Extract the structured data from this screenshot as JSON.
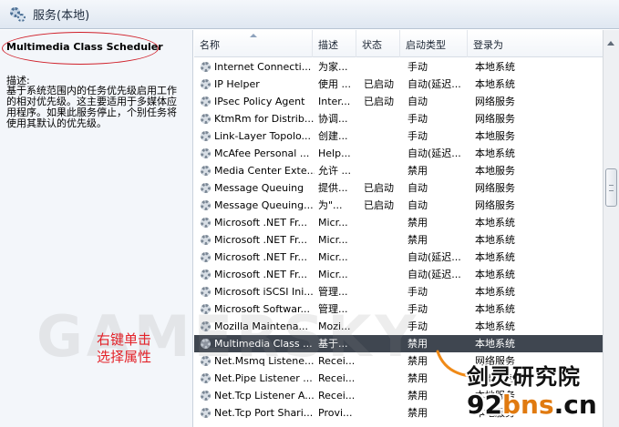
{
  "window": {
    "title": "服务(本地)"
  },
  "details": {
    "service_name": "Multimedia Class Scheduler",
    "desc_label": "描述:",
    "desc_text": "基于系统范围内的任务优先级启用工作的相对优先级。这主要适用于多媒体应用程序。如果此服务停止，个别任务将使用其默认的优先级。"
  },
  "table": {
    "columns": [
      "名称",
      "描述",
      "状态",
      "启动类型",
      "登录为"
    ],
    "rows": [
      [
        "Internet Connecti...",
        "为家...",
        "",
        "手动",
        "本地系统"
      ],
      [
        "IP Helper",
        "使用 ...",
        "已启动",
        "自动(延迟...",
        "本地系统"
      ],
      [
        "IPsec Policy Agent",
        "Inter...",
        "已启动",
        "自动",
        "网络服务"
      ],
      [
        "KtmRm for Distrib...",
        "协调...",
        "",
        "手动",
        "网络服务"
      ],
      [
        "Link-Layer Topolo...",
        "创建...",
        "",
        "手动",
        "本地服务"
      ],
      [
        "McAfee Personal ...",
        "Help...",
        "",
        "自动(延迟...",
        "本地系统"
      ],
      [
        "Media Center Exte...",
        "允许 ...",
        "",
        "禁用",
        "本地服务"
      ],
      [
        "Message Queuing",
        "提供...",
        "已启动",
        "自动",
        "网络服务"
      ],
      [
        "Message Queuing...",
        "为\"...",
        "已启动",
        "自动",
        "网络服务"
      ],
      [
        "Microsoft .NET Fr...",
        "Micr...",
        "",
        "禁用",
        "本地系统"
      ],
      [
        "Microsoft .NET Fr...",
        "Micr...",
        "",
        "禁用",
        "本地系统"
      ],
      [
        "Microsoft .NET Fr...",
        "Micr...",
        "",
        "自动(延迟...",
        "本地系统"
      ],
      [
        "Microsoft .NET Fr...",
        "Micr...",
        "",
        "自动(延迟...",
        "本地系统"
      ],
      [
        "Microsoft iSCSI Ini...",
        "管理...",
        "",
        "手动",
        "本地系统"
      ],
      [
        "Microsoft Softwar...",
        "管理...",
        "",
        "手动",
        "本地系统"
      ],
      [
        "Mozilla Maintena...",
        "Mozi...",
        "",
        "手动",
        "本地系统"
      ],
      [
        "Multimedia Class ...",
        "基于...",
        "",
        "禁用",
        "本地系统"
      ],
      [
        "Net.Msmq Listene...",
        "Recei...",
        "",
        "禁用",
        "网络服务"
      ],
      [
        "Net.Pipe Listener ...",
        "Recei...",
        "",
        "禁用",
        "本地服务"
      ],
      [
        "Net.Tcp Listener A...",
        "Recei...",
        "",
        "禁用",
        "本地服务"
      ],
      [
        "Net.Tcp Port Shari...",
        "Provi...",
        "",
        "禁用",
        "本地服务"
      ]
    ],
    "selected_index": 16
  },
  "annotation": {
    "line1": "右键单击",
    "line2": "选择属性"
  },
  "watermark": {
    "text": "GAMERSKY"
  },
  "site": {
    "name": "剑灵研究院",
    "url_prefix": "92",
    "url_accent": "bns",
    "url_suffix": ".cn"
  },
  "colors": {
    "annotation": "#e32229",
    "selected_row": "#3f4650",
    "ellipse": "#d0202a"
  },
  "icons": {
    "title": "services-gear-icon",
    "row": "service-gear-icon"
  }
}
